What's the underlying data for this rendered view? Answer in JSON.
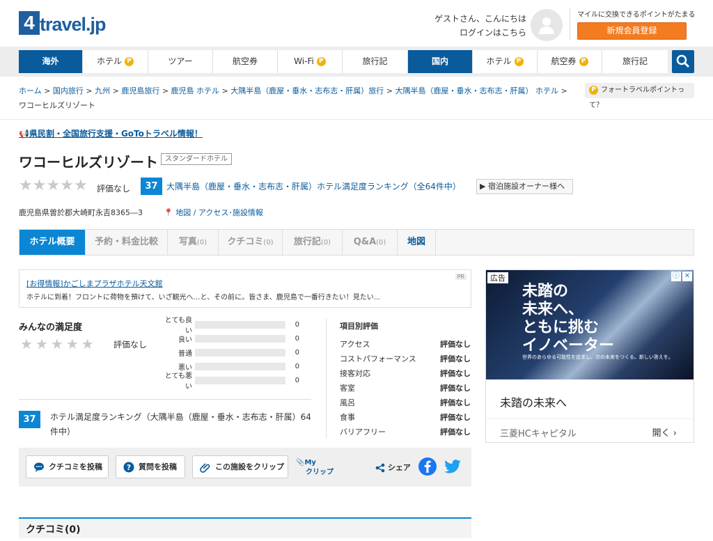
{
  "header": {
    "logo_four": "4",
    "logo_word": "travel.jp",
    "greeting": "ゲストさん、こんにちは",
    "login": "ログインはこちら",
    "points_note": "マイルに交換できるポイントがたまる",
    "register": "新規会員登録"
  },
  "nav": {
    "items": [
      {
        "label": "海外"
      },
      {
        "label": "ホテル",
        "badge": "P"
      },
      {
        "label": "ツアー"
      },
      {
        "label": "航空券"
      },
      {
        "label": "Wi-Fi",
        "badge": "P"
      },
      {
        "label": "旅行記"
      },
      {
        "label": "国内"
      },
      {
        "label": "ホテル",
        "badge": "P"
      },
      {
        "label": "航空券",
        "badge": "P"
      },
      {
        "label": "旅行記"
      }
    ]
  },
  "breadcrumb": {
    "items": [
      "ホーム",
      "国内旅行",
      "九州",
      "鹿児島旅行",
      "鹿児島 ホテル",
      "大隅半島（鹿屋・垂水・志布志・肝属）旅行",
      "大隅半島（鹿屋・垂水・志布志・肝属） ホテル"
    ],
    "sep": ">",
    "current": "ワコーヒルズリゾート",
    "points_btn": "フォートラベルポイントって？",
    "points_badge": "P"
  },
  "goto_link": "県民割・全国旅行支援・GoToトラベル情報！",
  "hotel": {
    "name": "ワコーヒルズリゾート",
    "category": "スタンダードホテル",
    "rating_text": "評価なし",
    "rank_number": "37",
    "rank_text": "大隅半島（鹿屋・垂水・志布志・肝属）ホテル満足度ランキング（全64件中）",
    "owner_btn": "宿泊施設オーナー様へ",
    "address": "鹿児島県曽於郡大崎町永吉8365―3",
    "map_link": "地図 / アクセス･施設情報"
  },
  "tabs": [
    {
      "label": "ホテル概要",
      "count": ""
    },
    {
      "label": "予約・料金比較",
      "count": ""
    },
    {
      "label": "写真",
      "count": "(0)"
    },
    {
      "label": "クチコミ",
      "count": "(0)"
    },
    {
      "label": "旅行記",
      "count": "(0)"
    },
    {
      "label": "Q&A",
      "count": "(0)"
    },
    {
      "label": "地図",
      "count": ""
    }
  ],
  "promo": {
    "link": "[お得情報]かごしまプラザホテル天文館",
    "desc": "ホテルに到着！フロントに荷物を預けて、いざ観光へ…と、その前に。皆さま、鹿児島で一番行きたい！見たい...",
    "pr": "PR"
  },
  "satisfaction": {
    "title": "みんなの満足度",
    "rating_text": "評価なし",
    "bars": [
      {
        "label": "とても良い",
        "count": 0
      },
      {
        "label": "良い",
        "count": 0
      },
      {
        "label": "普通",
        "count": 0
      },
      {
        "label": "悪い",
        "count": 0
      },
      {
        "label": "とても悪い",
        "count": 0
      }
    ],
    "items_title": "項目別評価",
    "items": [
      {
        "label": "アクセス",
        "value": "評価なし"
      },
      {
        "label": "コストパフォーマンス",
        "value": "評価なし"
      },
      {
        "label": "接客対応",
        "value": "評価なし"
      },
      {
        "label": "客室",
        "value": "評価なし"
      },
      {
        "label": "風呂",
        "value": "評価なし"
      },
      {
        "label": "食事",
        "value": "評価なし"
      },
      {
        "label": "バリアフリー",
        "value": "評価なし"
      }
    ],
    "rank_number": "37",
    "rank_text": "ホテル満足度ランキング（大隅半島（鹿屋・垂水・志布志・肝属）64件中）"
  },
  "actions": {
    "review": "クチコミを投稿",
    "question": "質問を投稿",
    "clip": "この施設をクリップ",
    "myclip_1": "My",
    "myclip_2": "クリップ",
    "share": "シェア"
  },
  "kuchikomi_heading": "クチコミ(0)",
  "ad": {
    "tag": "広告",
    "headline_1": "未踏の",
    "headline_2": "未来へ、",
    "headline_3": "ともに挑む",
    "headline_4": "イノベーター",
    "sub": "世界のあらゆる可能性を追求し、次の未来をつくる。新しい答えを。",
    "title": "未踏の未来へ",
    "advertiser": "三菱HCキャピタル",
    "open": "開く"
  },
  "colors": {
    "brand_blue": "#0a5b9c",
    "accent_blue": "#0a86d4",
    "orange": "#f37b20",
    "point_yellow": "#f0b400"
  }
}
